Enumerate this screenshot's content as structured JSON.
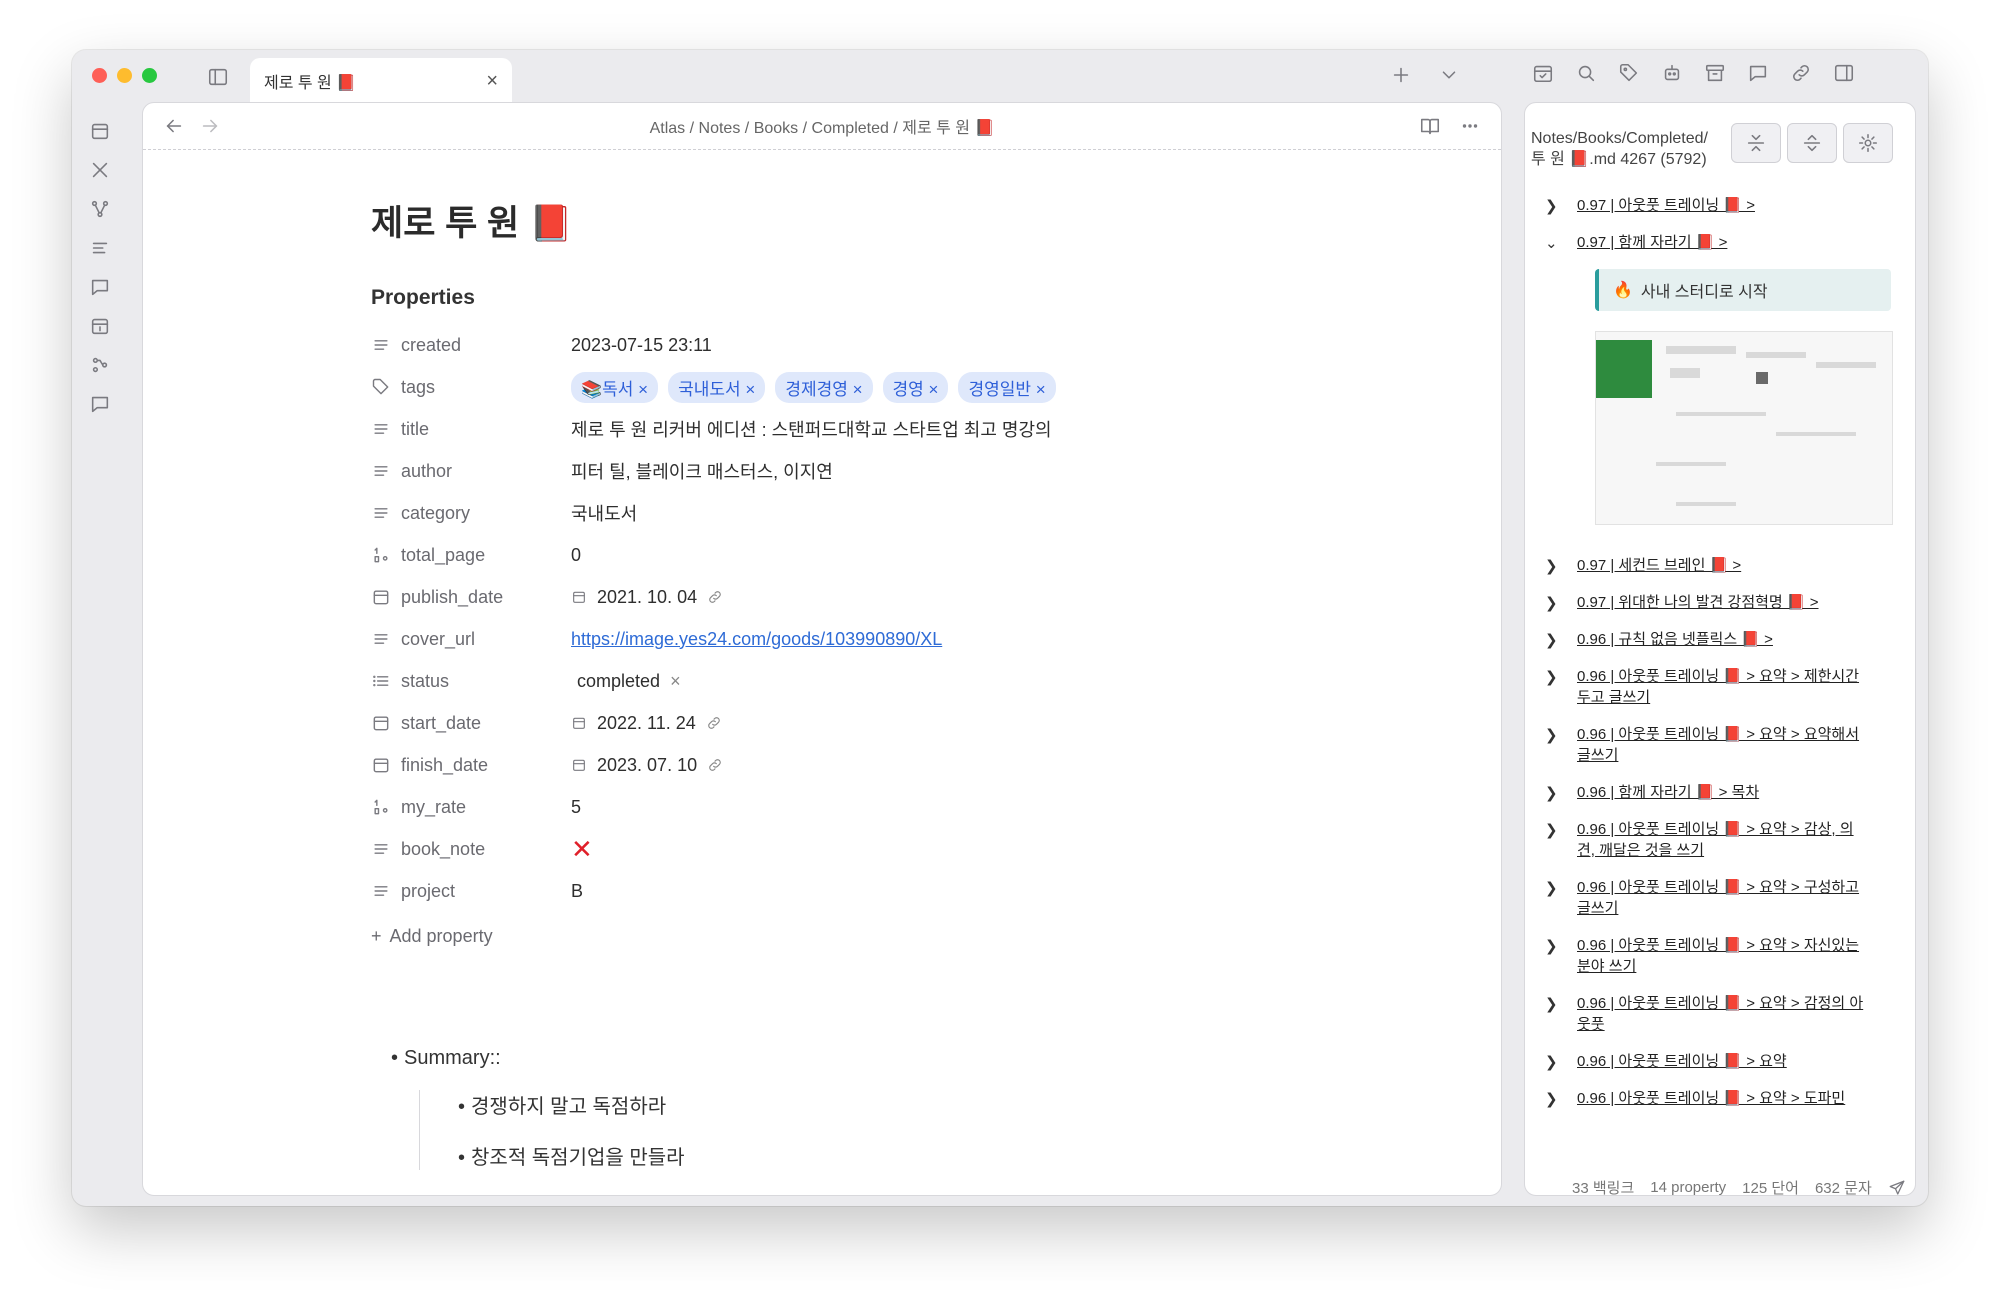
{
  "tab": {
    "title": "제로 투 원 📕",
    "close": "×"
  },
  "breadcrumb": {
    "items": [
      "Atlas",
      "Notes",
      "Books",
      "Completed",
      "제로 투 원 📕"
    ],
    "sep": "/"
  },
  "doc": {
    "title": "제로 투 원 📕",
    "properties_heading": "Properties",
    "properties": {
      "created": {
        "key": "created",
        "value": "2023-07-15 23:11"
      },
      "tags": {
        "key": "tags",
        "values": [
          "📚독서",
          "국내도서",
          "경제경영",
          "경영",
          "경영일반"
        ]
      },
      "title": {
        "key": "title",
        "value": "제로 투 원 리커버 에디션 : 스탠퍼드대학교 스타트업 최고 명강의"
      },
      "author": {
        "key": "author",
        "value": "피터 틸, 블레이크 매스터스, 이지연"
      },
      "category": {
        "key": "category",
        "value": "국내도서"
      },
      "total_page": {
        "key": "total_page",
        "value": "0"
      },
      "publish_date": {
        "key": "publish_date",
        "value": "2021. 10. 04"
      },
      "cover_url": {
        "key": "cover_url",
        "value": "https://image.yes24.com/goods/103990890/XL"
      },
      "status": {
        "key": "status",
        "value": "completed"
      },
      "start_date": {
        "key": "start_date",
        "value": "2022. 11. 24"
      },
      "finish_date": {
        "key": "finish_date",
        "value": "2023. 07. 10"
      },
      "my_rate": {
        "key": "my_rate",
        "value": "5"
      },
      "book_note": {
        "key": "book_note",
        "value": "✕"
      },
      "project": {
        "key": "project",
        "value": "B"
      }
    },
    "add_property": "Add property",
    "summary": {
      "label": "Summary::",
      "children": [
        "경쟁하지 말고 독점하라",
        "창조적 독점기업을 만들라"
      ]
    }
  },
  "side_panel": {
    "path_line1": "Notes/Books/Completed/",
    "path_line2": "투 원 📕.md 4267 (5792)",
    "callout": "사내 스터디로 시작",
    "items_top": [
      {
        "label": "0.97 | 아웃풋 트레이닝 📕 >",
        "expanded": false
      },
      {
        "label": "0.97 | 함께 자라기 📕 >",
        "expanded": true
      }
    ],
    "items": [
      {
        "label": "0.97 | 세컨드 브레인 📕 >"
      },
      {
        "label": "0.97 | 위대한 나의 발견 강점혁명 📕 >"
      },
      {
        "label": "0.96 | 규칙 없음 넷플릭스 📕 >"
      },
      {
        "label": "0.96 | 아웃풋 트레이닝 📕 > 요약 > 제한시간 두고 글쓰기"
      },
      {
        "label": "0.96 | 아웃풋 트레이닝 📕 > 요약 > 요약해서 글쓰기"
      },
      {
        "label": "0.96 | 함께 자라기 📕 > 목차"
      },
      {
        "label": "0.96 | 아웃풋 트레이닝 📕 > 요약 > 감상, 의견, 깨달은 것을 쓰기"
      },
      {
        "label": "0.96 | 아웃풋 트레이닝 📕 > 요약 > 구성하고 글쓰기"
      },
      {
        "label": "0.96 | 아웃풋 트레이닝 📕 > 요약 > 자신있는 분야 쓰기"
      },
      {
        "label": "0.96 | 아웃풋 트레이닝 📕 > 요약 > 감정의 아웃풋"
      },
      {
        "label": "0.96 | 아웃풋 트레이닝 📕 > 요약"
      },
      {
        "label": "0.96 | 아웃풋 트레이닝 📕 > 요약 > 도파민"
      }
    ]
  },
  "status_bar": {
    "backlinks": "33 백링크",
    "properties": "14 property",
    "words": "125 단어",
    "chars": "632 문자"
  }
}
